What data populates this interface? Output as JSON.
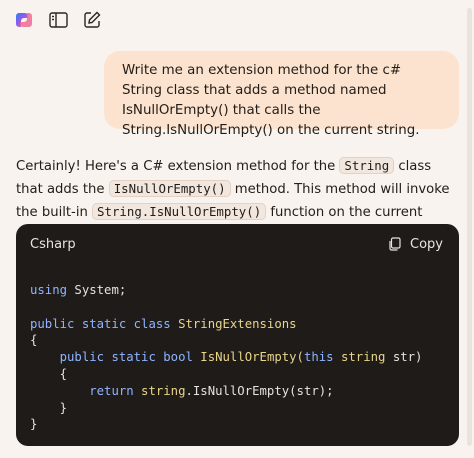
{
  "toolbar": {
    "icons": [
      "copilot-logo-icon",
      "sidebar-toggle-icon",
      "new-chat-icon"
    ]
  },
  "user_message": {
    "text": "Write me an extension method for the c# String class that adds a method named IsNullOrEmpty() that calls the String.IsNullOrEmpty() on the current string."
  },
  "reply": {
    "p1": "Certainly! Here's a C# extension method for the ",
    "code1": "String",
    "p2": " class that adds the ",
    "code2": "IsNullOrEmpty()",
    "p3": " method. This method will invoke the built-in ",
    "code3": "String.IsNullOrEmpty()",
    "p4": " function on the current string instance:"
  },
  "code_block": {
    "language": "Csharp",
    "copy_label": "Copy",
    "lines": {
      "l1_kw": "using",
      "l1_rest": " System;",
      "l3_kw": "public static class",
      "l3_name": " StringExtensions",
      "l4": "{",
      "l5_indent": "    ",
      "l5_kw": "public static",
      "l5_ret": " bool",
      "l5_name": " IsNullOrEmpty(",
      "l5_this": "this",
      "l5_type": " string",
      "l5_rest": " str)",
      "l6": "    {",
      "l7_indent": "        ",
      "l7_kw": "return",
      "l7_type": " string",
      "l7_rest": ".IsNullOrEmpty(str);",
      "l8": "    }",
      "l9": "}"
    }
  },
  "colors": {
    "background": "#f8f3ee",
    "user_bubble": "#fbe3cf",
    "code_bg": "#1f1b19",
    "keyword": "#8fb4ff",
    "type": "#e8d48a"
  }
}
